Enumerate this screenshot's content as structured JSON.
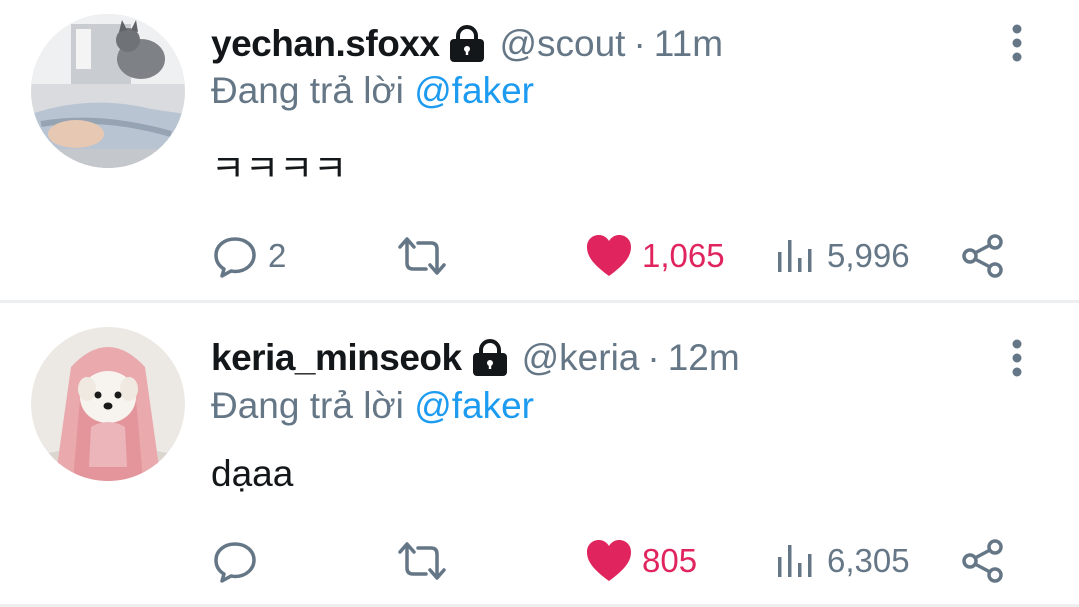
{
  "tweets": [
    {
      "display_name": "yechan.sfoxx",
      "handle": "@scout",
      "separator": "·",
      "time": "11m",
      "reply_prefix": "Đang trả lời",
      "reply_to": "@faker",
      "text": "ㅋㅋㅋㅋ",
      "replies": "2",
      "retweets": "",
      "likes": "1,065",
      "views": "5,996",
      "avatar_icon": "cat-avatar",
      "liked": true
    },
    {
      "display_name": "keria_minseok",
      "handle": "@keria",
      "separator": "·",
      "time": "12m",
      "reply_prefix": "Đang trả lời",
      "reply_to": "@faker",
      "text": "dạaa",
      "replies": "",
      "retweets": "",
      "likes": "805",
      "views": "6,305",
      "avatar_icon": "dog-avatar",
      "liked": true
    }
  ],
  "colors": {
    "accent": "#1d9bf0",
    "like": "#e0245e",
    "muted": "#657786",
    "text": "#14171a"
  },
  "icons": [
    "lock-icon",
    "more-vertical-icon",
    "reply-icon",
    "retweet-icon",
    "heart-icon",
    "views-icon",
    "share-icon"
  ]
}
